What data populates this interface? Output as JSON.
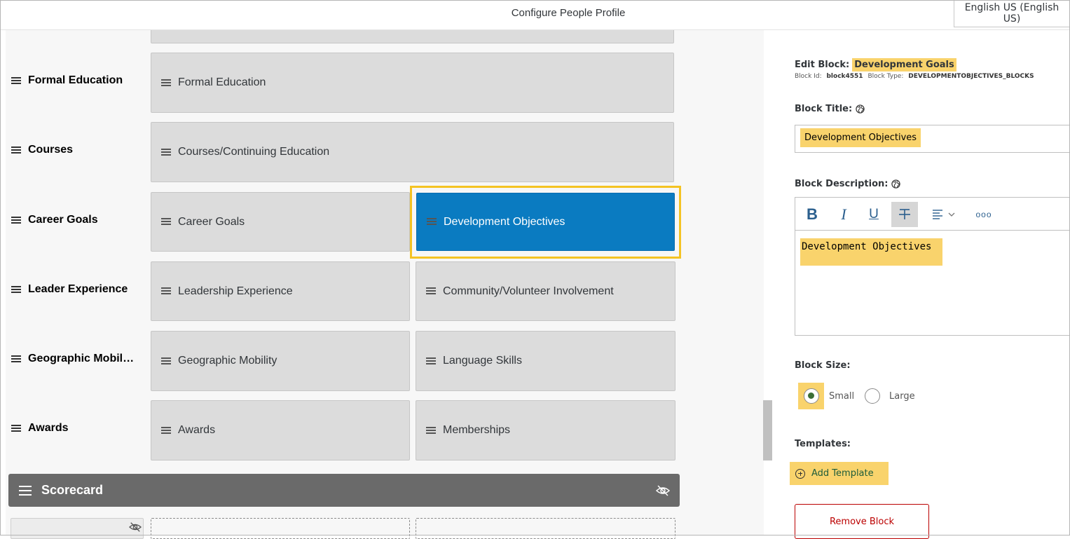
{
  "header": {
    "title": "Configure People Profile",
    "language": "English US (English US)"
  },
  "rows": [
    {
      "label": "Formal Education",
      "blocks": [
        "Formal Education"
      ]
    },
    {
      "label": "Courses",
      "blocks": [
        "Courses/Continuing Education"
      ]
    },
    {
      "label": "Career Goals",
      "blocks": [
        "Career Goals",
        "Development Objectives"
      ]
    },
    {
      "label": "Leader Experience",
      "blocks": [
        "Leadership Experience",
        "Community/Volunteer Involvement"
      ]
    },
    {
      "label": "Geographic Mobil…",
      "blocks": [
        "Geographic Mobility",
        "Language Skills"
      ]
    },
    {
      "label": "Awards",
      "blocks": [
        "Awards",
        "Memberships"
      ]
    }
  ],
  "scorecard": {
    "title": "Scorecard"
  },
  "editor": {
    "edit_block_label": "Edit Block:",
    "edit_block_name": "Development Goals",
    "block_id_label": "Block Id:",
    "block_id": "block4551",
    "block_type_label": "Block Type:",
    "block_type": "DEVELOPMENTOBJECTIVES_BLOCKS",
    "block_title_label": "Block Title:",
    "block_title_value": "Development Objectives",
    "block_desc_label": "Block Description:",
    "block_desc_value": "Development Objectives",
    "block_size_label": "Block Size:",
    "size_small": "Small",
    "size_large": "Large",
    "selected_size": "Small",
    "templates_label": "Templates:",
    "add_template": "Add Template",
    "remove_block": "Remove Block"
  },
  "toolbar": {
    "bold": "B",
    "italic": "I",
    "underline": "U",
    "more": "ooo"
  },
  "colors": {
    "selected_block": "#0a7bc1",
    "highlight": "#f9d36c",
    "focus_outline": "#f4c323",
    "scorecard_bar": "#6a6a6a",
    "remove": "#bb0000"
  },
  "icons": [
    "hamburger-icon",
    "globe-icon",
    "eye-slash-icon",
    "add-circle-icon",
    "align-left-icon",
    "chevron-down-icon",
    "strikethrough-icon"
  ]
}
